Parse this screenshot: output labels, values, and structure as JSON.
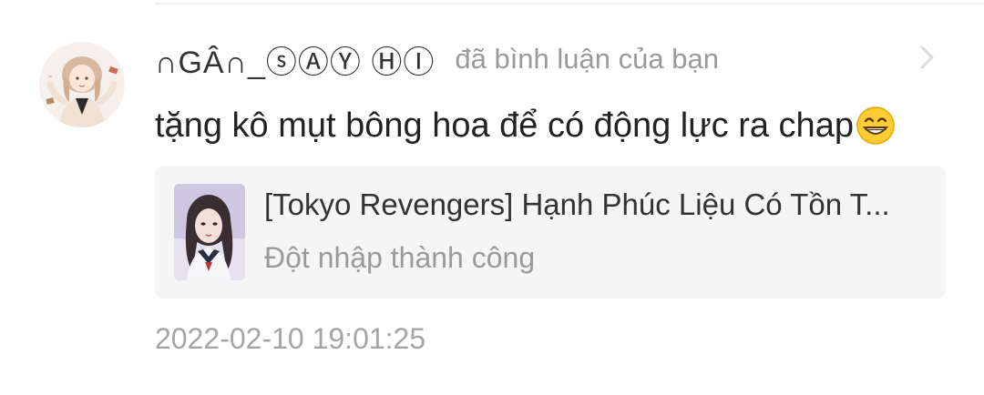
{
  "notification": {
    "username": "∩GÂ∩_ⓢⒶⓎ ⒽⒾ",
    "action_text": "đã bình luận của bạn",
    "comment_text": "tặng kô mụt bông hoa để có động lực ra chap",
    "timestamp": "2022-02-10 19:01:25"
  },
  "story_card": {
    "title": "[Tokyo Revengers] Hạnh Phúc Liệu Có Tồn T...",
    "subtitle": "Đột nhập thành công"
  },
  "icons": {
    "avatar": "avatar-illustration",
    "chevron": "chevron-right-icon",
    "emoji": "grinning-emoji",
    "cover": "story-cover-image"
  },
  "colors": {
    "username": "#333333",
    "muted": "#9a9a9a",
    "card_background": "#f5f5f5"
  }
}
